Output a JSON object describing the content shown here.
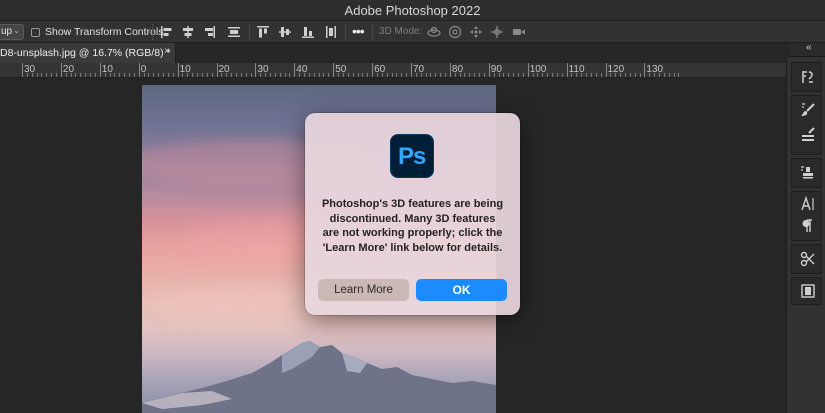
{
  "window": {
    "title": "Adobe Photoshop 2022"
  },
  "options_bar": {
    "auto_select_value": "up",
    "show_transform_label": "Show Transform Controls",
    "mode_3d_label": "3D Mode:",
    "more_label": "•••"
  },
  "document_tab": {
    "label": "D8-unsplash.jpg @ 16.7% (RGB/8) *",
    "close_label": "×"
  },
  "ruler": {
    "numbers": [
      "30",
      "20",
      "10",
      "0",
      "10",
      "20",
      "30",
      "40",
      "50",
      "60",
      "70",
      "80",
      "90",
      "100",
      "110",
      "120",
      "130"
    ]
  },
  "right_panel": {
    "collapse_label": "«"
  },
  "dialog": {
    "logo_text": "Ps",
    "message": "Photoshop's 3D features are being discontinued. Many 3D features are not working properly; click the 'Learn More' link below for details.",
    "learn_more_label": "Learn More",
    "ok_label": "OK"
  },
  "colors": {
    "accent_blue": "#1b8bff",
    "ps_logo_bg": "#001e36",
    "ps_logo_text": "#31a8ff"
  }
}
